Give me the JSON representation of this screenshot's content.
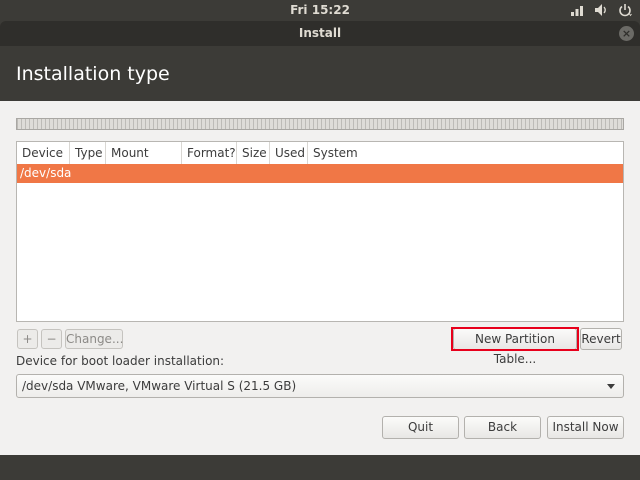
{
  "top_panel": {
    "clock": "Fri 15:22",
    "icons": [
      "network-icon",
      "volume-icon",
      "power-icon"
    ]
  },
  "window": {
    "title": "Install"
  },
  "page": {
    "title": "Installation type"
  },
  "table": {
    "columns": [
      "Device",
      "Type",
      "Mount point",
      "Format?",
      "Size",
      "Used",
      "System"
    ],
    "rows": [
      {
        "device": "/dev/sda",
        "selected": true
      }
    ]
  },
  "toolbar": {
    "add_label": "+",
    "remove_label": "−",
    "change_label": "Change...",
    "new_partition_table_label": "New Partition Table...",
    "revert_label": "Revert"
  },
  "bootloader": {
    "label": "Device for boot loader installation:",
    "selected_value": "/dev/sda VMware, VMware Virtual S (21.5 GB)"
  },
  "actions": {
    "quit_label": "Quit",
    "back_label": "Back",
    "install_now_label": "Install Now"
  },
  "colors": {
    "selection": "#f07746",
    "highlight_box": "#e8001c",
    "panel": "#3c3b37"
  }
}
